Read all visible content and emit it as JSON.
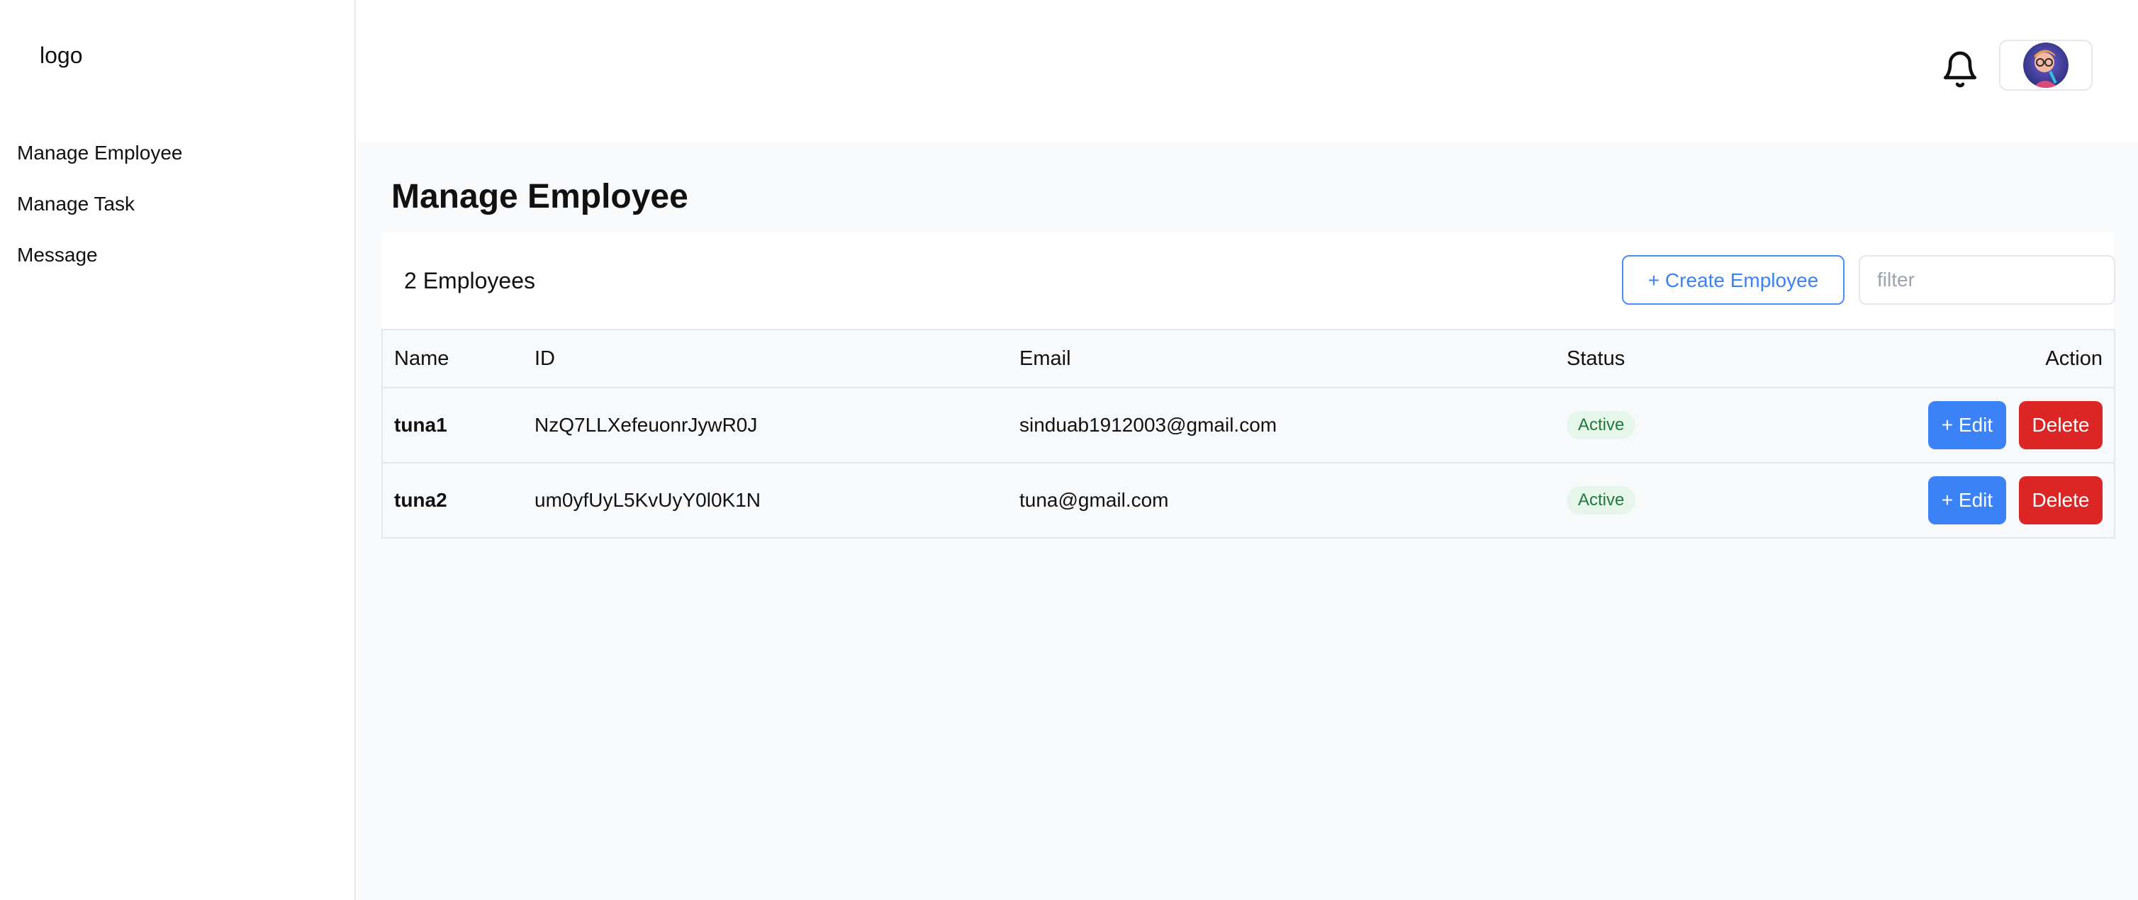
{
  "sidebar": {
    "logo": "logo",
    "items": [
      {
        "label": "Manage Employee"
      },
      {
        "label": "Manage Task"
      },
      {
        "label": "Message"
      }
    ]
  },
  "header": {
    "bell_icon": "bell-icon",
    "avatar": "user-avatar"
  },
  "main": {
    "title": "Manage Employee",
    "count_label": "2 Employees",
    "create_button": "+ Create Employee",
    "filter_placeholder": "filter",
    "table": {
      "headers": [
        "Name",
        "ID",
        "Email",
        "Status",
        "Action"
      ],
      "rows": [
        {
          "name": "tuna1",
          "id": "NzQ7LLXefeuonrJywR0J",
          "email": "sinduab1912003@gmail.com",
          "status": "Active",
          "edit": "+ Edit",
          "delete": "Delete"
        },
        {
          "name": "tuna2",
          "id": "um0yfUyL5KvUyY0l0K1N",
          "email": "tuna@gmail.com",
          "status": "Active",
          "edit": "+ Edit",
          "delete": "Delete"
        }
      ]
    }
  },
  "colors": {
    "primary": "#3b82f6",
    "danger": "#dc2626",
    "active_badge_bg": "#e6f6ea",
    "active_badge_text": "#1f7a3b"
  }
}
